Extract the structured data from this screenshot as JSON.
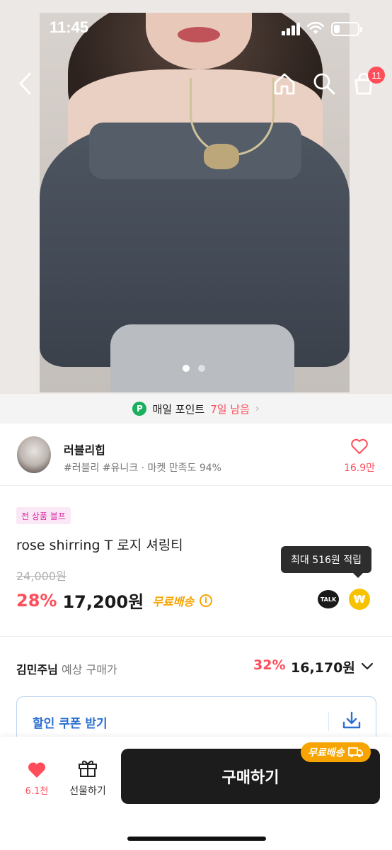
{
  "status_bar": {
    "time": "11:45",
    "battery_level": 0.25
  },
  "nav": {
    "back_icon": "chevron-left-icon",
    "home_icon": "home-icon",
    "search_icon": "search-icon",
    "cart_icon": "cart-icon",
    "cart_badge": "11"
  },
  "gallery": {
    "pages": 2,
    "active_index": 0
  },
  "point_banner": {
    "icon_text": "P",
    "label": "매일 포인트",
    "days_left": "7일 남음"
  },
  "seller": {
    "name": "러블리힙",
    "meta": "#러블리 #유니크 · 마켓 만족도 94%",
    "fav_count": "16.9만"
  },
  "product": {
    "tag": "전 상품 블프",
    "title": "rose shirring T 로지 셔링티",
    "original_price": "24,000원",
    "discount": "28%",
    "price": "17,200원",
    "free_shipping": "무료배송",
    "tooltip": "최대 516원 적립",
    "talk_label": "TALK",
    "won_symbol": "₩"
  },
  "expected": {
    "name": "김민주님",
    "label": " 예상 구매가",
    "percent": "32%",
    "price": "16,170원"
  },
  "coupon": {
    "label": "할인 쿠폰 받기"
  },
  "bottom_bar": {
    "like_count": "6.1천",
    "gift_label": "선물하기",
    "buy_label": "구매하기",
    "badge": "무료배송"
  },
  "colors": {
    "accent_red": "#ff4d5a",
    "shipping_orange": "#f7a400",
    "coupon_blue": "#2a6fd1",
    "point_green": "#1aaf5d"
  }
}
